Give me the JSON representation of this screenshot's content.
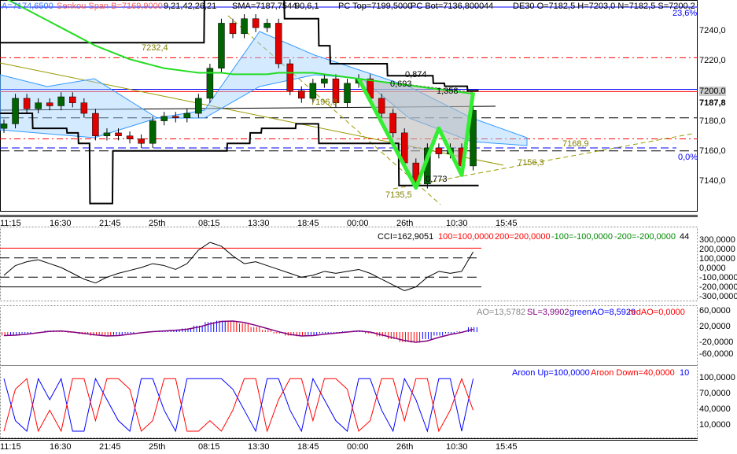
{
  "header": {
    "tenkan": "A=7174,6500",
    "senkou_b": "Senkou Span B=7169,9000",
    "ichimoku_params": "9,21,42,26,21",
    "sma": "SMA=7187,7544",
    "sma_params": "90,6,1",
    "pc_top": "PC Top=7199,5000",
    "pc_bot": "PC Bot=7136,8000",
    "pc_period": "44",
    "ohlc": "DE30 O=7182,5 H=7203,0 N=7182,5 S=7200,2"
  },
  "fib": {
    "top": "23,6%",
    "bottom": "0,0%"
  },
  "annotations": {
    "a1": "7232,4",
    "a2": "7196,8",
    "a3": "7135,5",
    "a4": "7156,3",
    "a5": "7168,9",
    "r1": "0,874",
    "r2": "0,693",
    "r3": "1,358",
    "r4": "0,773"
  },
  "price_axis": {
    "ticks": [
      "7240,0",
      "7220,0",
      "7200,0",
      "7180,0",
      "7160,0",
      "7140,0"
    ],
    "current": "7187,8"
  },
  "time_axis": [
    "11:15",
    "16:30",
    "21:45",
    "25th",
    "08:15",
    "13:30",
    "18:45",
    "00:00",
    "26th",
    "10:30",
    "15:45"
  ],
  "cci": {
    "legend": "CCI=162,9051",
    "l1": "100=100,0000",
    "l2": "200=200,0000",
    "l3": "-100=-100,0000",
    "l4": "-200=-200,0000",
    "period": "44",
    "ticks": [
      "300,0000",
      "200,0000",
      "100,0000",
      "0,0000",
      "-100,0000",
      "-200,0000",
      "-300,0000"
    ]
  },
  "ao": {
    "ao": "AO=13,5782",
    "sl": "SL=3,9902",
    "green": "greenAO=8,5929",
    "red": "redAO=0,0000",
    "ticks": [
      "60,0000",
      "20,0000",
      "-20,0000",
      "-60,0000"
    ]
  },
  "aroon": {
    "up": "Aroon Up=100,0000",
    "down": "Aroon Down=40,0000",
    "period": "10",
    "ticks": [
      "100,0000",
      "70,0000",
      "40,0000",
      "10,0000"
    ]
  },
  "colors": {
    "up": "#006400",
    "down": "#e00000",
    "sma": "#22dd22",
    "pattern": "#33ee33",
    "blue": "#0000ff",
    "red": "#ff0000"
  },
  "chart_data": {
    "type": "candlestick",
    "symbol": "DE30",
    "close": [
      7178,
      7195,
      7188,
      7192,
      7190,
      7196,
      7192,
      7185,
      7170,
      7172,
      7170,
      7168,
      7165,
      7180,
      7183,
      7182,
      7185,
      7195,
      7215,
      7245,
      7238,
      7248,
      7242,
      7245,
      7218,
      7200,
      7195,
      7205,
      7208,
      7192,
      7205,
      7208,
      7195,
      7185,
      7172,
      7152,
      7138,
      7162,
      7158,
      7162,
      7150,
      7187
    ],
    "sma": [
      7262,
      7258,
      7254,
      7250,
      7246,
      7242,
      7238,
      7234,
      7230,
      7227,
      7224,
      7221,
      7219,
      7217,
      7215,
      7214,
      7213,
      7212,
      7212,
      7212,
      7211,
      7211,
      7211,
      7211,
      7212,
      7212,
      7212,
      7212,
      7211,
      7210,
      7209,
      7208,
      7207,
      7206,
      7205,
      7204,
      7203,
      7202,
      7201,
      7200,
      7199,
      7198
    ],
    "pc_top": [
      7232,
      7232,
      7232,
      7232,
      7232,
      7232,
      7232,
      7232,
      7232,
      7232,
      7232,
      7232,
      7232,
      7232,
      7232,
      7232,
      7232,
      7232,
      7262,
      7262,
      7262,
      7262,
      7262,
      7262,
      7262,
      7248,
      7248,
      7248,
      7230,
      7218,
      7218,
      7218,
      7218,
      7218,
      7210,
      7210,
      7210,
      7210,
      7205,
      7203,
      7203,
      7200
    ],
    "pc_bot": [
      7185,
      7185,
      7185,
      7175,
      7175,
      7175,
      7172,
      7165,
      7125,
      7125,
      7160,
      7160,
      7160,
      7160,
      7160,
      7160,
      7160,
      7160,
      7160,
      7160,
      7165,
      7165,
      7172,
      7175,
      7175,
      7175,
      7178,
      7178,
      7165,
      7165,
      7165,
      7165,
      7165,
      7165,
      7165,
      7137,
      7137,
      7137,
      7137,
      7137,
      7137,
      7137
    ],
    "pattern": [
      [
        31,
        7208
      ],
      [
        36,
        7135.5
      ],
      [
        38,
        7175
      ],
      [
        40,
        7144
      ],
      [
        41,
        7199
      ]
    ],
    "levels": {
      "red_dashdot": [
        7222,
        7168
      ],
      "blue_solid": 7200.2,
      "black_dashed": [
        7182,
        7160
      ],
      "fib_0": 7162
    },
    "cci": [
      -80,
      20,
      60,
      80,
      40,
      0,
      -60,
      -120,
      -160,
      -100,
      -60,
      -30,
      0,
      40,
      20,
      -20,
      40,
      180,
      260,
      220,
      120,
      40,
      60,
      20,
      -20,
      -60,
      -100,
      -80,
      -40,
      -60,
      -40,
      -20,
      -60,
      -120,
      -180,
      -240,
      -200,
      -100,
      -40,
      -60,
      -40,
      162
    ],
    "ao": [
      -10,
      -8,
      -4,
      0,
      4,
      2,
      -2,
      -6,
      -10,
      -12,
      -8,
      -4,
      0,
      2,
      4,
      6,
      10,
      18,
      28,
      32,
      30,
      24,
      14,
      6,
      -4,
      -10,
      -12,
      -8,
      -4,
      -2,
      2,
      4,
      -4,
      -12,
      -20,
      -28,
      -30,
      -20,
      -10,
      -4,
      2,
      13.6
    ],
    "aroon_up": [
      100,
      20,
      0,
      100,
      60,
      100,
      0,
      0,
      100,
      60,
      20,
      0,
      100,
      100,
      40,
      0,
      100,
      100,
      100,
      100,
      80,
      40,
      0,
      100,
      100,
      40,
      0,
      100,
      60,
      20,
      0,
      100,
      100,
      40,
      0,
      100,
      60,
      0,
      100,
      100,
      0,
      100
    ],
    "aroon_down": [
      0,
      80,
      100,
      0,
      40,
      0,
      100,
      100,
      20,
      100,
      100,
      80,
      0,
      20,
      100,
      100,
      0,
      0,
      20,
      0,
      40,
      100,
      100,
      0,
      60,
      100,
      100,
      20,
      100,
      100,
      80,
      0,
      20,
      100,
      100,
      20,
      100,
      100,
      0,
      40,
      100,
      40
    ],
    "price_range": [
      7125,
      7265
    ]
  }
}
